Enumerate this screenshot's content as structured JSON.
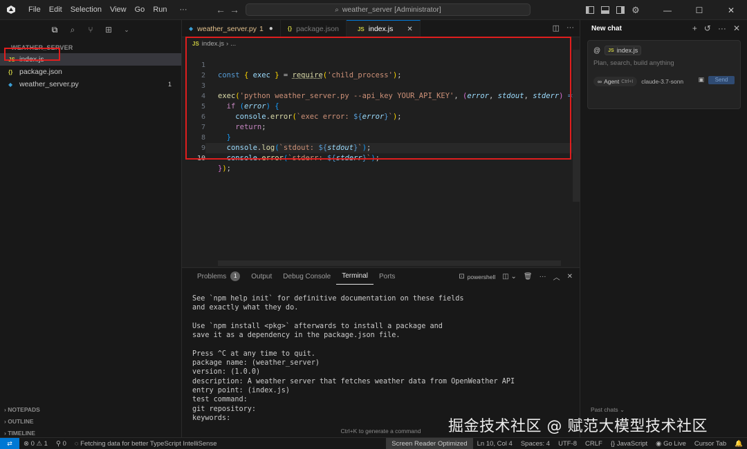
{
  "titlebar": {
    "menus": [
      "File",
      "Edit",
      "Selection",
      "View",
      "Go",
      "Run"
    ],
    "more": "···",
    "search_text": "weather_server [Administrator]"
  },
  "sidebar": {
    "section_title": "WEATHER_SERVER",
    "files": [
      {
        "icon": "JS",
        "name": "index.js",
        "badge": ""
      },
      {
        "icon": "{}",
        "name": "package.json",
        "badge": ""
      },
      {
        "icon": "py",
        "name": "weather_server.py",
        "badge": "1"
      }
    ],
    "bottom_sections": [
      "NOTEPADS",
      "OUTLINE",
      "TIMELINE"
    ]
  },
  "tabs": [
    {
      "icon": "py",
      "label": "weather_server.py",
      "extra": "1",
      "dirty": "●"
    },
    {
      "icon": "{}",
      "label": "package.json",
      "extra": "",
      "dirty": ""
    },
    {
      "icon": "JS",
      "label": "index.js",
      "extra": "",
      "dirty": "✕"
    }
  ],
  "breadcrumb": {
    "file": "index.js",
    "sep": "›",
    "rest": "..."
  },
  "editor": {
    "line_numbers": [
      "1",
      "2",
      "3",
      "4",
      "5",
      "6",
      "7",
      "8",
      "9",
      "10"
    ],
    "current_line": "10"
  },
  "panel": {
    "tabs": [
      "Problems",
      "Output",
      "Debug Console",
      "Terminal",
      "Ports"
    ],
    "problems_count": "1",
    "shell": "powershell",
    "terminal_lines": [
      "See `npm help init` for definitive documentation on these fields",
      "and exactly what they do.",
      "",
      "Use `npm install <pkg>` afterwards to install a package and",
      "save it as a dependency in the package.json file.",
      "",
      "Press ^C at any time to quit.",
      "package name: (weather_server)",
      "version: (1.0.0)",
      "description: A weather server that fetches weather data from OpenWeather API",
      "entry point: (index.js)",
      "test command:",
      "git repository:",
      "keywords:"
    ],
    "hint": "Ctrl+K to generate a command"
  },
  "chat": {
    "title": "New chat",
    "context_at": "@",
    "context_file": "index.js",
    "placeholder": "Plan, search, build anything",
    "agent_label": "Agent",
    "agent_kbd": "Ctrl+I",
    "model": "claude-3.7-sonn",
    "send": "Send",
    "past_chats": "Past chats ⌄"
  },
  "watermark": "掘金技术社区 @ 赋范大模型技术社区",
  "statusbar": {
    "problems": "⊗ 0 ⚠ 1",
    "ports": "⚲ 0",
    "message": "Fetching data for better TypeScript IntelliSense",
    "screen_reader": "Screen Reader Optimized",
    "position": "Ln 10, Col 4",
    "spaces": "Spaces: 4",
    "encoding": "UTF-8",
    "eol": "CRLF",
    "language": "{} JavaScript",
    "golive": "Go Live",
    "cursor_tab": "Cursor Tab"
  },
  "colors": {
    "accent": "#0078d4",
    "highlight_box": "#e01e1e",
    "js_icon": "#cbcb41",
    "json_icon": "#cbcb41",
    "py_icon": "#3b9fd6"
  }
}
